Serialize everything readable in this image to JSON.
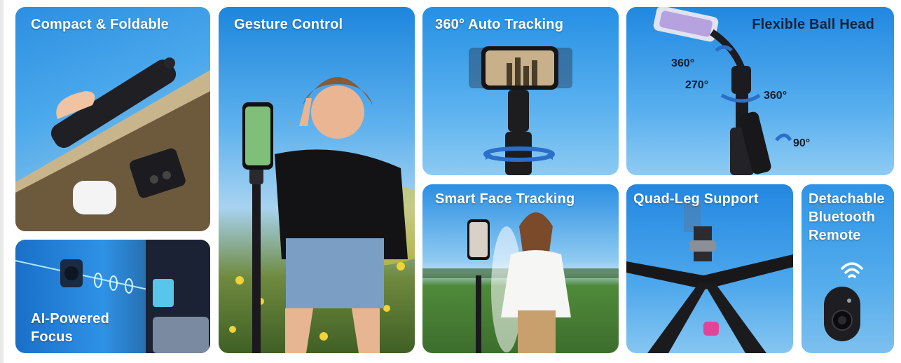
{
  "tiles": {
    "compact": {
      "title": "Compact & Foldable"
    },
    "ai_focus": {
      "title": "AI-Powered Focus"
    },
    "gesture": {
      "title": "Gesture Control"
    },
    "auto_tracking": {
      "title": "360° Auto Tracking"
    },
    "ball_head": {
      "title": "Flexible Ball Head",
      "angles": [
        "360°",
        "270°",
        "360°",
        "90°"
      ]
    },
    "face_tracking": {
      "title": "Smart Face Tracking"
    },
    "quad_leg": {
      "title": "Quad-Leg Support"
    },
    "remote": {
      "title": "Detachable Bluetooth Remote"
    }
  },
  "icons": {
    "bluetooth_signal": "wifi-signal-icon",
    "remote": "remote-control-icon"
  },
  "colors": {
    "sky_blue": "#2a8fe3",
    "title_text": "#ffffff",
    "remote_button": "#1e1e22",
    "pink_accent": "#e0459a"
  }
}
